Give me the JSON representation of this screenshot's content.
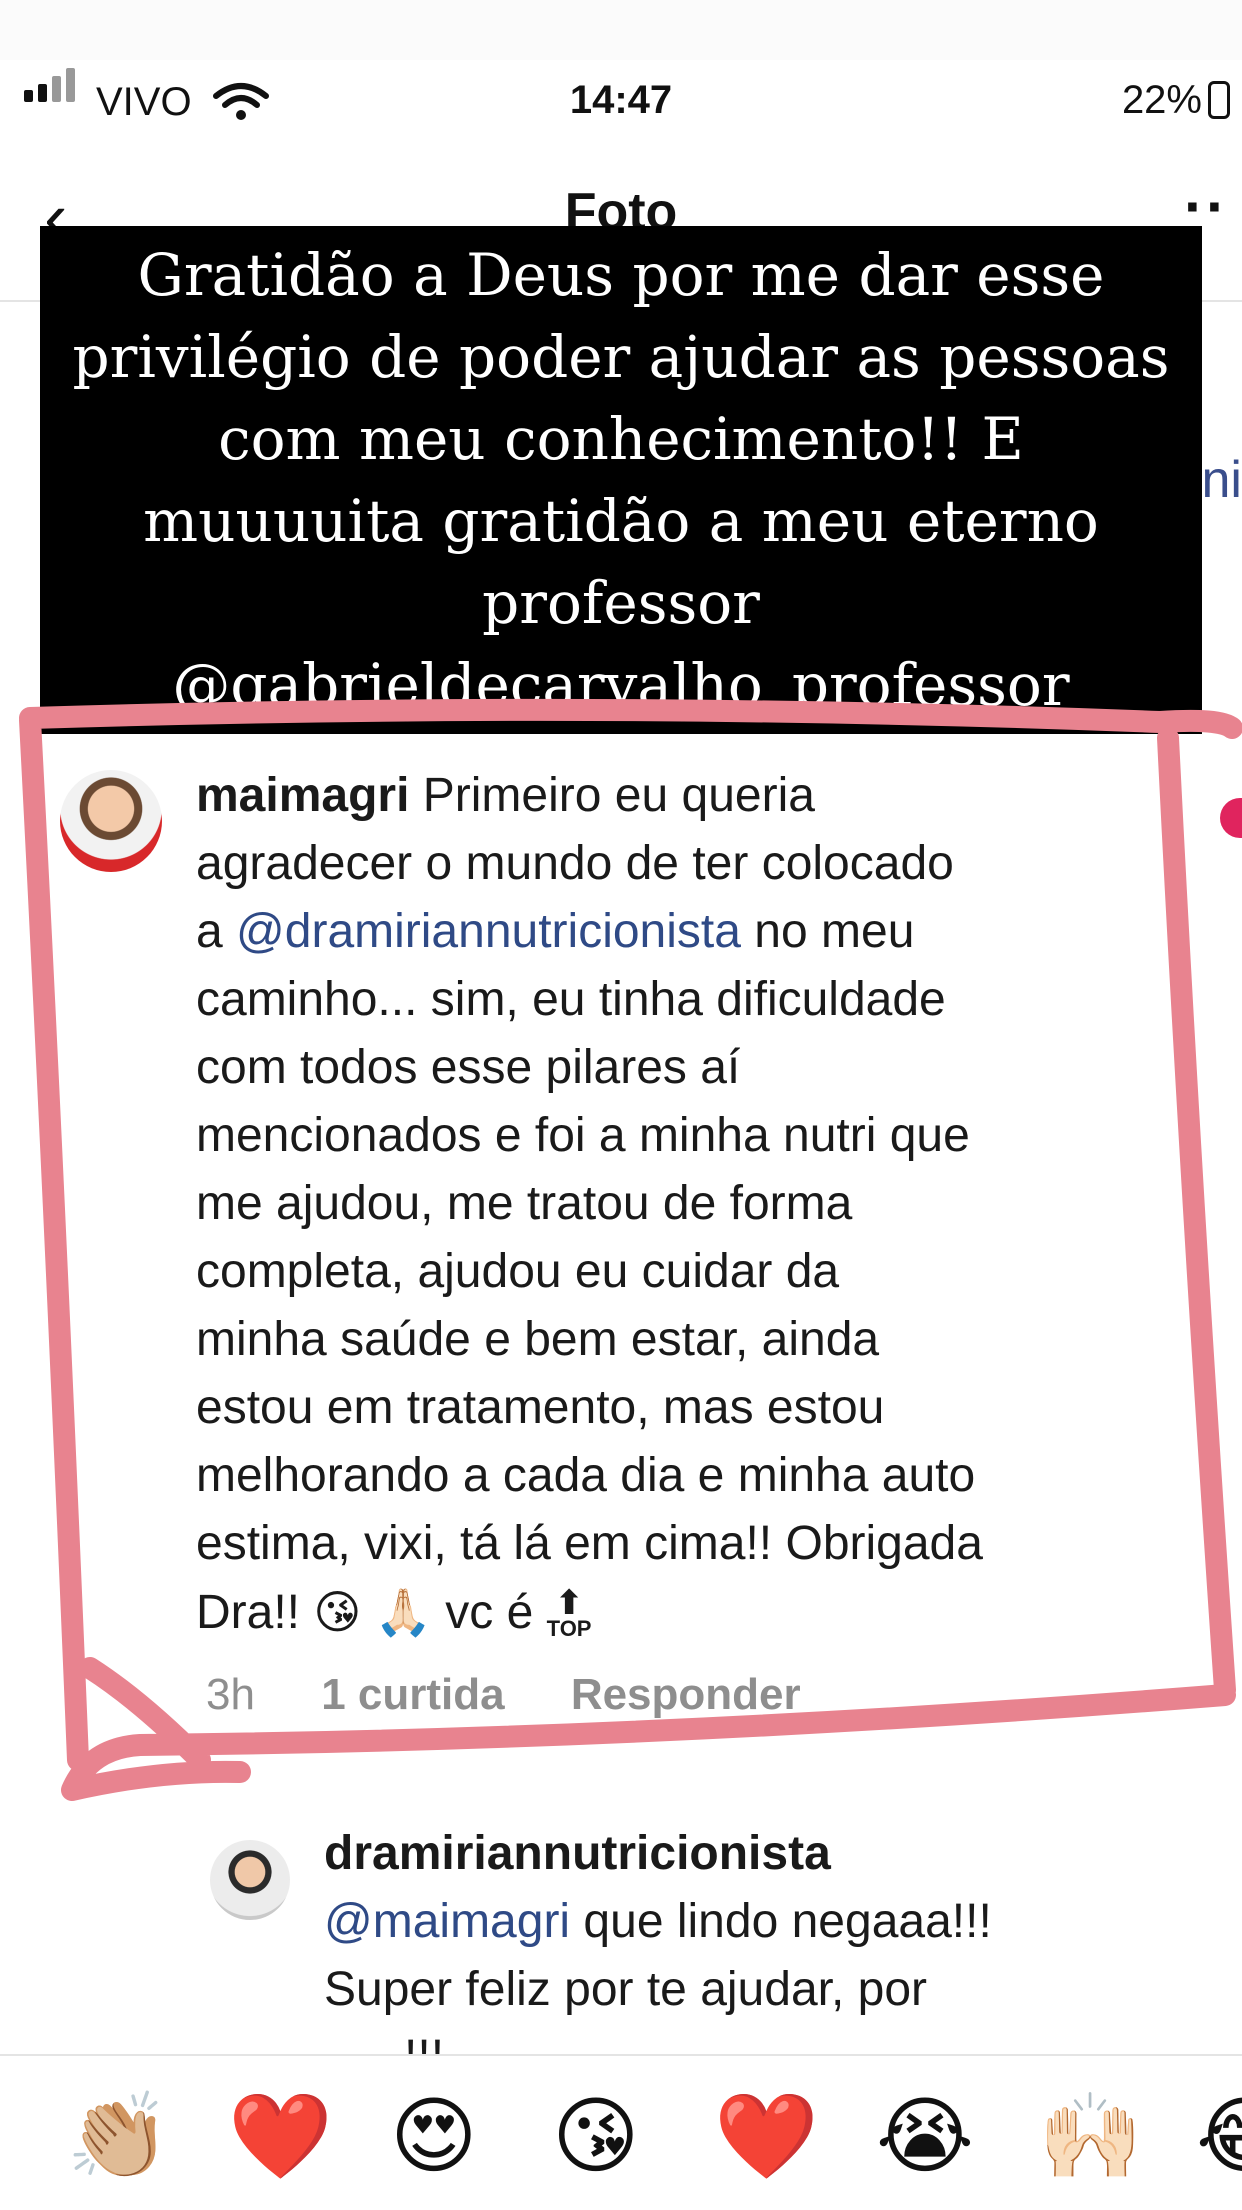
{
  "status_bar": {
    "carrier": "VIVO",
    "time": "14:47",
    "battery": "22%"
  },
  "nav": {
    "title": "Foto",
    "back": "‹",
    "more": "··",
    "partial_text": "ni"
  },
  "caption": {
    "lines": [
      "Gratidão a Deus por me dar esse",
      "privilégio de poder ajudar as pessoas",
      "com meu conhecimento!! E",
      "muuuuita gratidão a meu eterno",
      "professor"
    ],
    "mention": "@gabrieldecarvalho_professor"
  },
  "comment": {
    "username": "maimagri",
    "line1": " Primeiro eu queria",
    "line2": "agradecer o mundo de ter colocado",
    "line3_prefix": "a ",
    "line3_mention": "@dramiriannutricionista",
    "line3_suffix": " no meu",
    "line4": "caminho... sim, eu tinha dificuldade",
    "line5": "com todos esse pilares aí",
    "line6": "mencionados e foi a minha nutri que",
    "line7": "me ajudou, me tratou de forma",
    "line8": "completa, ajudou eu cuidar da",
    "line9": "minha saúde e bem estar, ainda",
    "line10": "estou em tratamento, mas estou",
    "line11": "melhorando a cada dia e minha auto",
    "line12": "estima, vixi, tá lá em cima!! Obrigada",
    "line13_prefix": "Dra!! ",
    "emoji_kiss": "😘",
    "emoji_pray": "🙏🏻",
    "line13_mid": " vc é ",
    "top_arrow": "⬆",
    "top_label": "TOP",
    "time": "3h",
    "likes": "1 curtida",
    "reply": "Responder"
  },
  "reply": {
    "username": "dramiriannutricionista",
    "mention": "@maimagri",
    "line1_rest": " que lindo negaaa!!!",
    "line2": "Super feliz por te ajudar, por",
    "line3": "......!!!"
  },
  "reactions": [
    "👏🏼",
    "❤️",
    "😍",
    "😘",
    "❤️",
    "😭",
    "🙌🏻",
    "😂"
  ],
  "colors": {
    "pink_frame": "#e8838f",
    "link": "#2f4a86",
    "caption_bg": "#000000"
  }
}
